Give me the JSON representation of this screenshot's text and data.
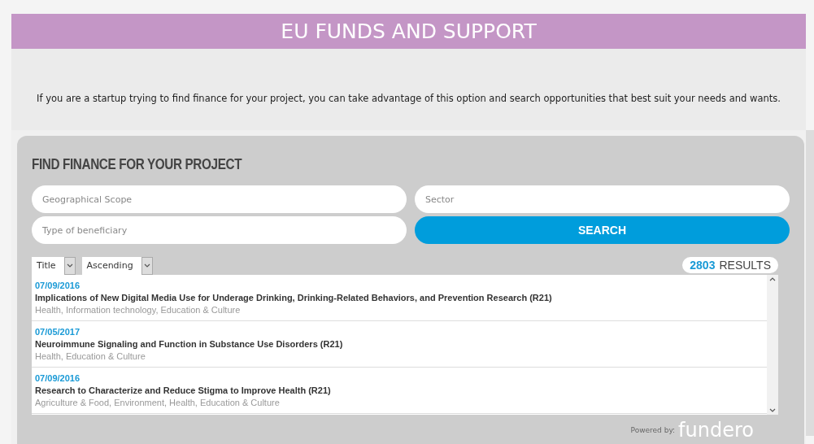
{
  "header": {
    "title": "EU FUNDS AND SUPPORT"
  },
  "intro": "If you are a startup trying to find finance for your project, you can take advantage of this option and search opportunities that best suit your needs and wants.",
  "finder": {
    "title": "FIND FINANCE FOR YOUR PROJECT",
    "fields": [
      {
        "placeholder": "Geographical Scope"
      },
      {
        "placeholder": "Sector"
      },
      {
        "placeholder": "Type of beneficiary"
      }
    ],
    "search_button": "SEARCH",
    "sort": [
      {
        "value": "Title"
      },
      {
        "value": "Ascending"
      }
    ],
    "results_count": "2803",
    "results_label": "RESULTS",
    "results": [
      {
        "date": "07/09/2016",
        "title": "Implications of New Digital Media Use for Underage Drinking, Drinking-Related Behaviors, and Prevention Research (R21)",
        "sectors": "Health, Information technology, Education & Culture"
      },
      {
        "date": "07/05/2017",
        "title": "Neuroimmune Signaling and Function in Substance Use Disorders (R21)",
        "sectors": "Health, Education & Culture"
      },
      {
        "date": "07/09/2016",
        "title": "Research to Characterize and Reduce Stigma to Improve Health (R21)",
        "sectors": "Agriculture & Food, Environment, Health, Education & Culture"
      }
    ],
    "powered_by": "Powered by:",
    "logo": "fundero"
  }
}
